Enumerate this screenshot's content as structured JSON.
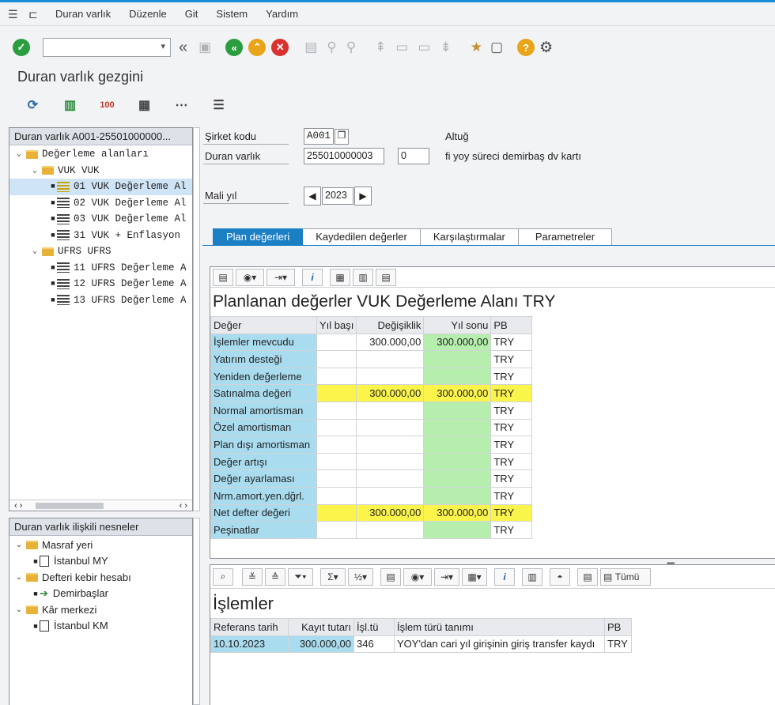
{
  "menu": {
    "items": [
      "Duran varlık",
      "Düzenle",
      "Git",
      "Sistem",
      "Yardım"
    ]
  },
  "window": {
    "title": "Duran varlık gezgini"
  },
  "nav": {
    "header": "Duran varlık A001-25501000000...",
    "tree": [
      {
        "label": "Değerleme alanları",
        "level": 0,
        "type": "folder"
      },
      {
        "label": "VUK VUK",
        "level": 1,
        "type": "folder"
      },
      {
        "label": "01 VUK Değerleme Al",
        "level": 2,
        "type": "item"
      },
      {
        "label": "02 VUK Değerleme Al",
        "level": 2,
        "type": "item"
      },
      {
        "label": "03 VUK Değerleme Al",
        "level": 2,
        "type": "item"
      },
      {
        "label": "31 VUK + Enflasyon",
        "level": 2,
        "type": "item"
      },
      {
        "label": "UFRS UFRS",
        "level": 1,
        "type": "folder"
      },
      {
        "label": "11 UFRS Değerleme A",
        "level": 2,
        "type": "item"
      },
      {
        "label": "12 UFRS Değerleme A",
        "level": 2,
        "type": "item"
      },
      {
        "label": "13 UFRS Değerleme A",
        "level": 2,
        "type": "item"
      }
    ]
  },
  "related": {
    "header": "Duran varlık ilişkili nesneler",
    "tree": [
      {
        "label": "Masraf yeri",
        "level": 0
      },
      {
        "label": "İstanbul MY",
        "level": 1
      },
      {
        "label": "Defteri kebir hesabı",
        "level": 0
      },
      {
        "label": "Demirbaşlar",
        "level": 1
      },
      {
        "label": "Kâr merkezi",
        "level": 0
      },
      {
        "label": "İstanbul KM",
        "level": 1
      }
    ]
  },
  "header": {
    "company_label": "Şirket kodu",
    "company_value": "A001",
    "company_name": "Altuğ",
    "asset_label": "Duran varlık",
    "asset_value": "255010000003",
    "asset_sub": "0",
    "asset_desc": "fi yoy süreci demirbaş dv kartı",
    "year_label": "Mali yıl",
    "year_value": "2023"
  },
  "tabs": [
    "Plan değerleri",
    "Kaydedilen değerler",
    "Karşılaştırmalar",
    "Parametreler"
  ],
  "plan": {
    "title": "Planlanan değerler VUK Değerleme Alanı TRY",
    "columns": [
      "Değer",
      "Yıl başı",
      "Değişiklik",
      "Yıl sonu",
      "PB"
    ],
    "rows": [
      {
        "label": "İşlemler mevcudu",
        "start": "",
        "change": "300.000,00",
        "end": "300.000,00",
        "cur": "TRY",
        "hl": false
      },
      {
        "label": "Yatırım desteği",
        "start": "",
        "change": "",
        "end": "",
        "cur": "TRY",
        "hl": false
      },
      {
        "label": "Yeniden değerleme",
        "start": "",
        "change": "",
        "end": "",
        "cur": "TRY",
        "hl": false
      },
      {
        "label": "Satınalma değeri",
        "start": "",
        "change": "300.000,00",
        "end": "300.000,00",
        "cur": "TRY",
        "hl": true
      },
      {
        "label": "Normal amortisman",
        "start": "",
        "change": "",
        "end": "",
        "cur": "TRY",
        "hl": false
      },
      {
        "label": "Özel amortisman",
        "start": "",
        "change": "",
        "end": "",
        "cur": "TRY",
        "hl": false
      },
      {
        "label": "Plan dışı amortisman",
        "start": "",
        "change": "",
        "end": "",
        "cur": "TRY",
        "hl": false
      },
      {
        "label": "Değer artışı",
        "start": "",
        "change": "",
        "end": "",
        "cur": "TRY",
        "hl": false
      },
      {
        "label": "Değer ayarlaması",
        "start": "",
        "change": "",
        "end": "",
        "cur": "TRY",
        "hl": false
      },
      {
        "label": "Nrm.amort.yen.dğrl.",
        "start": "",
        "change": "",
        "end": "",
        "cur": "TRY",
        "hl": false
      },
      {
        "label": "Net defter değeri",
        "start": "",
        "change": "300.000,00",
        "end": "300.000,00",
        "cur": "TRY",
        "hl": true
      },
      {
        "label": "Peşinatlar",
        "start": "",
        "change": "",
        "end": "",
        "cur": "TRY",
        "hl": false
      }
    ]
  },
  "trans": {
    "toolbar_all": "Tümü",
    "title": "İşlemler",
    "columns": [
      "Referans tarih",
      "Kayıt tutarı",
      "İşl.tü",
      "İşlem türü tanımı",
      "PB"
    ],
    "rows": [
      {
        "date": "10.10.2023",
        "amount": "300.000,00",
        "type": "346",
        "desc": "YOY'dan cari yıl girişinin giriş transfer kaydı",
        "cur": "TRY"
      }
    ]
  }
}
